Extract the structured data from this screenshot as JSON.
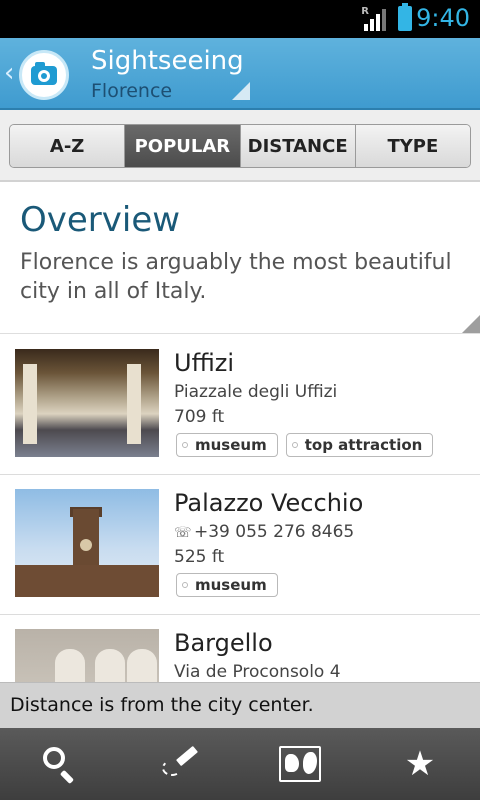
{
  "status_bar": {
    "time": "9:40",
    "roaming_label": "R"
  },
  "action_bar": {
    "title": "Sightseeing",
    "subtitle": "Florence",
    "logo_icon": "camera-icon"
  },
  "tabs": [
    {
      "label": "A-Z",
      "active": false
    },
    {
      "label": "POPULAR",
      "active": true
    },
    {
      "label": "DISTANCE",
      "active": false
    },
    {
      "label": "TYPE",
      "active": false
    }
  ],
  "overview": {
    "title": "Overview",
    "text": "Florence is arguably the most beautiful city in all of Italy."
  },
  "places": [
    {
      "name": "Uffizi",
      "line1": "Piazzale degli Uffizi",
      "line1_icon": "",
      "line2": "709 ft",
      "tags": [
        "museum",
        "top attraction"
      ]
    },
    {
      "name": "Palazzo Vecchio",
      "line1": "+39 055 276 8465",
      "line1_icon": "☏",
      "line2": "525 ft",
      "tags": [
        "museum"
      ]
    },
    {
      "name": "Bargello",
      "line1": "Via de Proconsolo 4",
      "line1_icon": "",
      "line2": "",
      "tags": []
    }
  ],
  "toast": {
    "text": "Distance is from the city center."
  },
  "bottom_bar": [
    "search-icon",
    "guide-pencil-icon",
    "world-map-icon",
    "favorites-star-icon"
  ],
  "colors": {
    "accent": "#33b5e5",
    "action_bar": "#4fa7d6",
    "heading": "#1a5978"
  }
}
